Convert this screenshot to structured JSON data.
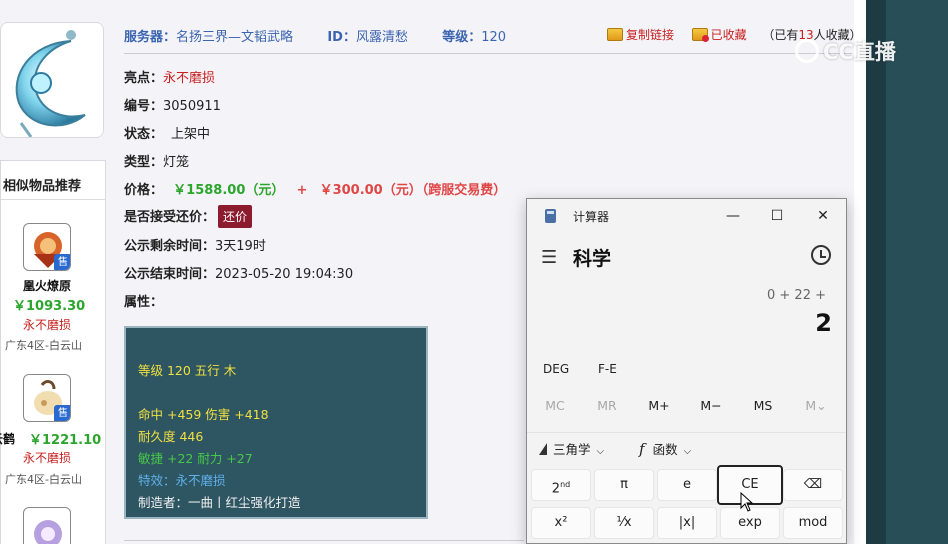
{
  "header": {
    "server_label": "服务器：",
    "server_value": "名扬三界—文韬武略",
    "id_label": "ID：",
    "id_value": "风露清愁",
    "level_label": "等级：",
    "level_value": "120",
    "copy_link": "复制链接",
    "favorited": "已收藏",
    "fav_count_prefix": "（已有",
    "fav_count": "13",
    "fav_count_suffix": "人收藏）"
  },
  "details": {
    "highlight_label": "亮点：",
    "highlight_value": "永不磨损",
    "number_label": "编号：",
    "number_value": "3050911",
    "status_label": "状态：",
    "status_value": "上架中",
    "type_label": "类型：",
    "type_value": "灯笼",
    "price_label": "价格：",
    "price_main": "￥1588.00（元）",
    "price_plus": "+",
    "price_fee": "￥300.00（元）（跨服交易费）",
    "counter_label": "是否接受还价：",
    "counter_button": "还价",
    "remaining_label": "公示剩余时间：",
    "remaining_value": "3天19时",
    "end_label": "公示结束时间：",
    "end_value": "2023-05-20 19:04:30",
    "attr_label": "属性："
  },
  "attributes": {
    "level_line": "等级 120 五行 木",
    "hit_line": "命中 +459 伤害 +418",
    "durability_line": "耐久度 446",
    "agility_line": "敏捷 +22 耐力 +27",
    "effect_line": "特效：永不磨损",
    "maker_line": "制造者：一曲丨红尘强化打造"
  },
  "similar": {
    "title": "相似物品推荐",
    "items": [
      {
        "name": "凰火燎原",
        "price": "￥1093.30",
        "noware": "永不磨损",
        "server": "广东4区-白云山",
        "badge": "售"
      },
      {
        "name": "云鹤",
        "price": "￥1221.10",
        "noware": "永不磨损",
        "server": "广东4区-白云山",
        "badge": "售"
      }
    ]
  },
  "calculator": {
    "app_title": "计算器",
    "mode": "科学",
    "expression": "0 + 22 +",
    "display": "2",
    "deg": "DEG",
    "fe": "F-E",
    "mem": [
      "MC",
      "MR",
      "M+",
      "M−",
      "MS",
      "M⌄"
    ],
    "trig": "三角学",
    "func": "函数",
    "row1": [
      "2nd",
      "π",
      "e",
      "CE",
      "⌫"
    ],
    "row2": [
      "x²",
      "¹⁄x",
      "|x|",
      "exp",
      "mod"
    ]
  },
  "watermark": "CC直播",
  "colors": {
    "link_blue": "#3b64b0",
    "price_green": "#2ca52c",
    "alert_red": "#c81e1e",
    "counter_button": "#8c1b2e",
    "attr_box_bg": "#2e5562"
  }
}
